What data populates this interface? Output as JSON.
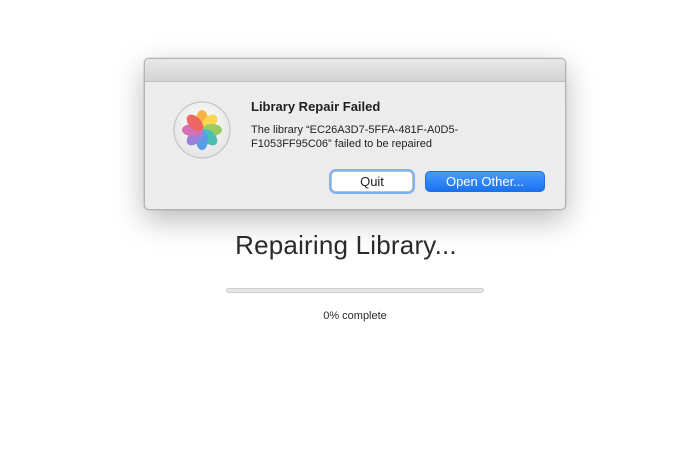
{
  "background": {
    "title": "Repairing Library...",
    "progress_percent": 0,
    "progress_label": "0% complete"
  },
  "alert": {
    "icon": "photos-app-icon",
    "title": "Library Repair Failed",
    "message": "The library “EC26A3D7-5FFA-481F-A0D5-F1053FF95C06” failed to be repaired",
    "buttons": {
      "quit": "Quit",
      "open_other": "Open Other..."
    }
  },
  "colors": {
    "accent": "#1a72f0",
    "focus_ring": "#7fb1f0"
  }
}
